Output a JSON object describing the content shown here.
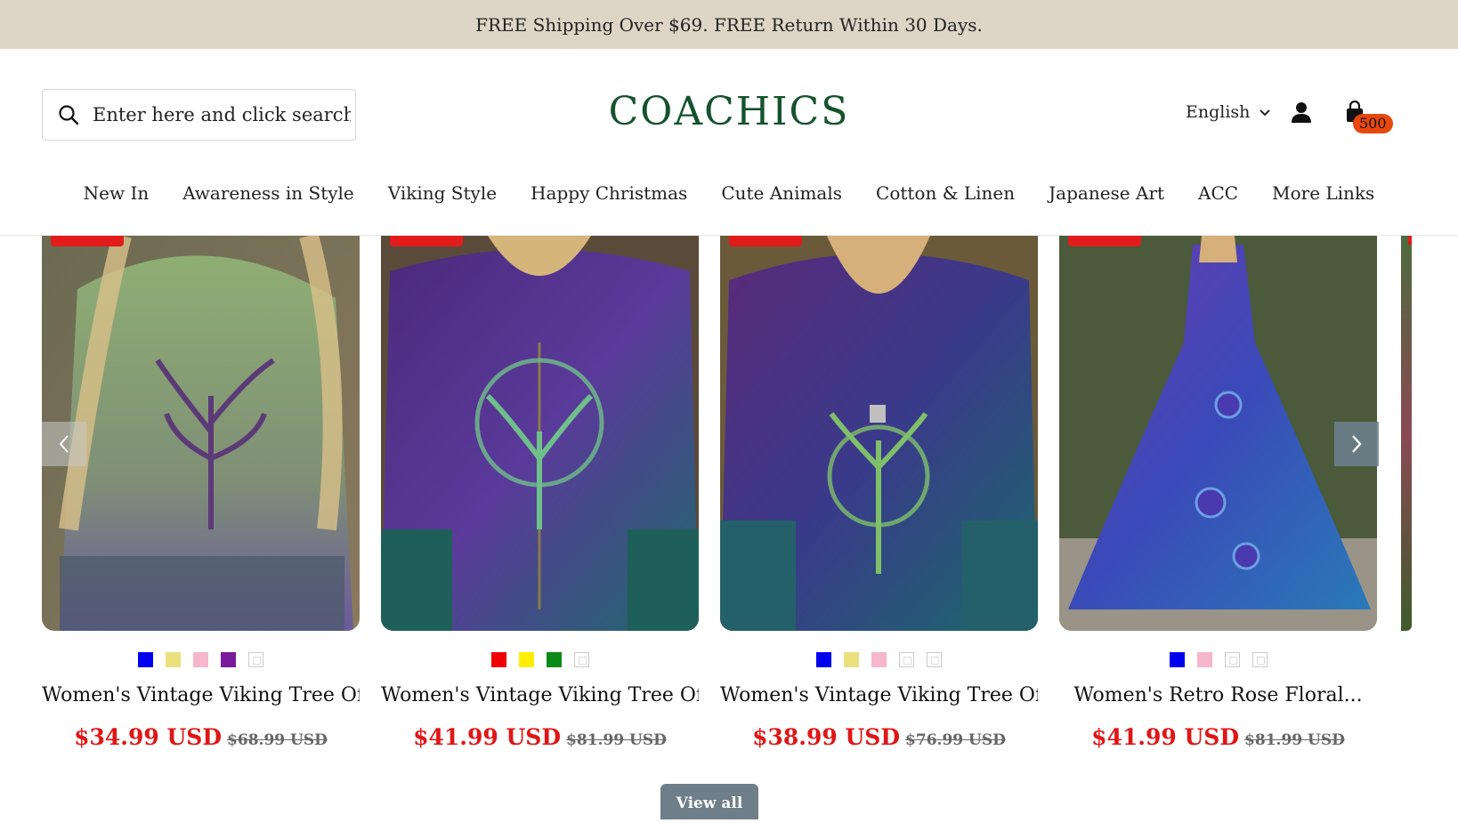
{
  "announcement": "FREE Shipping Over $69. FREE Return Within 30 Days.",
  "header": {
    "search_placeholder": "Enter here and click search",
    "logo": "COACHICS",
    "language": "English",
    "cart_count": "500"
  },
  "nav": [
    "New In",
    "Awareness in Style",
    "Viking Style",
    "Happy Christmas",
    "Cute Animals",
    "Cotton & Linen",
    "Japanese Art",
    "ACC",
    "More Links"
  ],
  "products": [
    {
      "title": "Women's Vintage Viking Tree Of...",
      "price": "$34.99 USD",
      "old_price": "$68.99 USD",
      "swatches": [
        "#0000ee",
        "#ebe07e",
        "#f6b6cc",
        "#7a1a9c",
        "multi"
      ]
    },
    {
      "title": "Women's Vintage Viking Tree Of...",
      "price": "$41.99 USD",
      "old_price": "$81.99 USD",
      "swatches": [
        "#ee0000",
        "#ffee00",
        "#0b8a17",
        "multi"
      ]
    },
    {
      "title": "Women's Vintage Viking Tree Of...",
      "price": "$38.99 USD",
      "old_price": "$76.99 USD",
      "swatches": [
        "#0000ee",
        "#ebe07e",
        "#f6b6cc",
        "multi",
        "multi"
      ]
    },
    {
      "title": "Women's Retro Rose Floral...",
      "price": "$41.99 USD",
      "old_price": "$81.99 USD",
      "swatches": [
        "#0000ee",
        "#f6b6cc",
        "multi",
        "multi"
      ]
    }
  ],
  "view_all": "View all",
  "colors": {
    "announcement_bg": "#ddd5c6",
    "logo": "#14532d",
    "sale_price": "#e01616",
    "badge": "#e8470e"
  }
}
